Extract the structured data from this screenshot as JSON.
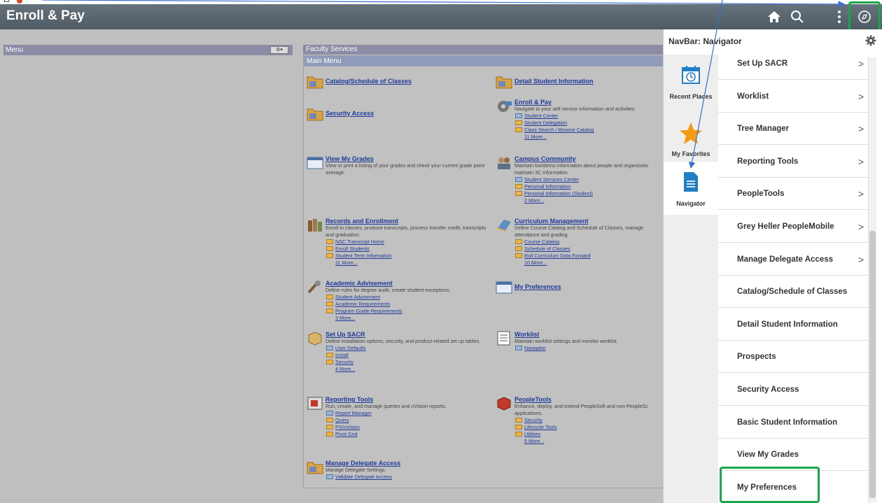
{
  "header": {
    "title": "Enroll & Pay"
  },
  "left_menu": {
    "title": "Menu",
    "control": "⚙▾"
  },
  "faculty": {
    "title": "Faculty Services",
    "main_menu": "Main Menu"
  },
  "tiles": [
    {
      "title": "Catalog/Schedule of Classes",
      "desc": "",
      "items": [],
      "more": ""
    },
    {
      "title": "Detail Student Information",
      "desc": "",
      "items": [],
      "more": ""
    },
    {
      "title": "Security Access",
      "desc": "",
      "items": [],
      "more": ""
    },
    {
      "title": "Enroll & Pay",
      "desc": "Navigate to your self service information and activities.",
      "items": [
        "Student Center",
        "Student Delegation",
        "Class Search / Browse Catalog"
      ],
      "more": "11 More..."
    },
    {
      "title": "View My Grades",
      "desc": "View or print a listing of your grades and check your current grade point average.",
      "items": [],
      "more": ""
    },
    {
      "title": "Campus Community",
      "desc": "Maintain bio/demo information about people and organizatio maintain 3C information.",
      "items": [
        "Student Services Center",
        "Personal Information",
        "Personal Information (Student)"
      ],
      "more": "2 More..."
    },
    {
      "title": "Records and Enrollment",
      "desc": "Enroll in classes, produce transcripts, process transfer credit, transcripts and graduation.",
      "items": [
        "NSC Transcript Home",
        "Enroll Students",
        "Student Term Information"
      ],
      "more": "11 More..."
    },
    {
      "title": "Curriculum Management",
      "desc": "Define Course Catalog and Schedule of Classes, manage attendance and grading.",
      "items": [
        "Course Catalog",
        "Schedule of Classes",
        "Roll Curriculum Data Forward"
      ],
      "more": "10 More..."
    },
    {
      "title": "Academic Advisement",
      "desc": "Define rules for degree audit, create student exceptions.",
      "items": [
        "Student Advisement",
        "Academic Requirements",
        "Program Guide Requirements"
      ],
      "more": "3 More..."
    },
    {
      "title": "My Preferences",
      "desc": "",
      "items": [],
      "more": ""
    },
    {
      "title": "Set Up SACR",
      "desc": "Define installation options, security, and product-related set up tables.",
      "items": [
        "User Defaults",
        "Install",
        "Security"
      ],
      "more": "4 More..."
    },
    {
      "title": "Worklist",
      "desc": "Maintain worklist settings and monitor worklist.",
      "items": [
        "Navigator"
      ],
      "more": ""
    },
    {
      "title": "Reporting Tools",
      "desc": "Run, create, and manage queries and nVision reports.",
      "items": [
        "Report Manager",
        "Query",
        "PS/nVision",
        "Pivot Grid"
      ],
      "more": ""
    },
    {
      "title": "PeopleTools",
      "desc": "Enhance, deploy, and extend PeopleSoft and non-PeopleSc applications.",
      "items": [
        "Security",
        "Lifecycle Tools",
        "Utilities"
      ],
      "more": "5 More..."
    },
    {
      "title": "Manage Delegate Access",
      "desc": "Manage Delegate Settings",
      "items": [
        "Validate Delegate Access"
      ],
      "more": ""
    }
  ],
  "navbar": {
    "title": "NavBar: Navigator",
    "side": [
      "Recent Places",
      "My Favorites",
      "Navigator"
    ],
    "items": [
      {
        "label": "Set Up SACR",
        "chevron": ">"
      },
      {
        "label": "Worklist",
        "chevron": ">"
      },
      {
        "label": "Tree Manager",
        "chevron": ">"
      },
      {
        "label": "Reporting Tools",
        "chevron": ">"
      },
      {
        "label": "PeopleTools",
        "chevron": ">"
      },
      {
        "label": "Grey Heller PeopleMobile",
        "chevron": ">"
      },
      {
        "label": "Manage Delegate Access",
        "chevron": ">"
      },
      {
        "label": "Catalog/Schedule of Classes",
        "chevron": ""
      },
      {
        "label": "Detail Student Information",
        "chevron": ""
      },
      {
        "label": "Prospects",
        "chevron": ""
      },
      {
        "label": "Security Access",
        "chevron": ""
      },
      {
        "label": "Basic Student Information",
        "chevron": ""
      },
      {
        "label": "View My Grades",
        "chevron": ""
      },
      {
        "label": "My Preferences",
        "chevron": ""
      }
    ]
  },
  "colors": {
    "highlight": "#18a84a",
    "arrow": "#3a6fd1"
  }
}
